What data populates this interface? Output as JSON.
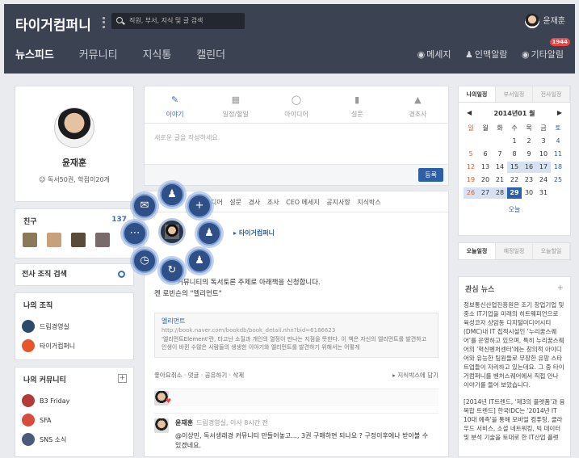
{
  "app": {
    "title": "타이거컴퍼니",
    "search_placeholder": "직원, 부서, 지식 및 글 검색",
    "user_name": "윤재훈"
  },
  "nav": {
    "tabs": [
      "뉴스피드",
      "커뮤니티",
      "지식통",
      "캘린더"
    ],
    "right": [
      {
        "label": "메세지",
        "icon": "chat-icon"
      },
      {
        "label": "인맥알람",
        "icon": "person-plus-icon"
      },
      {
        "label": "기타알림",
        "icon": "globe-icon",
        "badge": "1944"
      }
    ]
  },
  "profile": {
    "name": "윤재훈",
    "stats": "독서50권, 학점이20개"
  },
  "friends": {
    "title": "친구",
    "count": "137"
  },
  "org_search": {
    "label": "전사 조직 검색"
  },
  "my_org": {
    "title": "나의 조직",
    "items": [
      "드림경영실",
      "타이거컴퍼니"
    ]
  },
  "my_community": {
    "title": "나의 커뮤니티",
    "items": [
      "B3 Friday",
      "SFA",
      "SNS 소식"
    ]
  },
  "compose": {
    "tabs": [
      "이야기",
      "일정/할일",
      "아이디어",
      "설문",
      "경조사"
    ],
    "placeholder": "새로운 글을 작성하세요.",
    "submit": "등록"
  },
  "feed": {
    "filters": [
      "디어",
      "설문",
      "경사",
      "조사",
      "CEO 메세지",
      "공지사항",
      "지식박스"
    ],
    "org": "타이거컴퍼니",
    "post_line1": "커뮤니티의 독서토론 주제로 아래책을 신청합니다.",
    "post_line2": "켄 로빈슨의 \"엘리먼트\"",
    "link_title": "엘리먼트",
    "link_url": "http://book.naver.com/bookdb/book_detail.nhn?bid=6186623",
    "link_desc": "'엘리먼트Element'란, 타고난 소질과 개인의 열정이 만나는 지점을 뜻한다. 이 책은 자신의 엘리먼트를 발견하고 인생이 바뀐 수많은 사람들의 생생한 이야기와 엘리먼트를 발견하기 위해서는 어떻게",
    "actions": [
      "좋아요취소",
      "댓글",
      "공유하기",
      "삭제"
    ],
    "action_right": "지식박스에 담기",
    "comment_name": "윤재훈",
    "comment_meta": "드림경영실, 이사 8시간 전",
    "comment_text": "@이상민, 독서생래경 커뮤니티 만들어놓고..., 3권 구매하면 되나요 ? 구정이후에나 받아볼 수 있겠네요."
  },
  "calendar": {
    "tabs": [
      "나의일정",
      "부서일정",
      "전사일정"
    ],
    "month": "2014년01 월",
    "weekdays": [
      "일",
      "월",
      "화",
      "수",
      "목",
      "금",
      "토"
    ],
    "days": [
      "",
      "",
      "",
      "1",
      "2",
      "3",
      "4",
      "5",
      "6",
      "7",
      "8",
      "9",
      "10",
      "11",
      "12",
      "13",
      "14",
      "15",
      "16",
      "17",
      "18",
      "19",
      "20",
      "21",
      "22",
      "23",
      "24",
      "25",
      "26",
      "27",
      "28",
      "29",
      "30",
      "31",
      ""
    ],
    "today_label": "오늘"
  },
  "today_tabs": [
    "오늘일정",
    "예정일정",
    "오늘할일"
  ],
  "news": {
    "title": "관심 뉴스",
    "p1": "정보통신산업진흥원은 조기 창업기업 및 중소 IT기업을 미래의 히트웨피언으로 육성코자 상암동 디지털미디어시티(DMC)내 IT 집적시설인 '누리꿈스퀘어'를 운영하고 있으며, 특히 누리꿈스퀘어의 '혁신벤처센터'에는 창의적 아이디어와 유능한 팀원들로 무장한 유망 스타트업들이 자리하고 있는데요. 그 중 타이거컴퍼니를 벤처스퀘어에서 직접 만나 이야기를 들어 보았습니다.",
    "p2": "[2014년 IT트렌드, '제3의 플랫폼'과 융복합 트렌드] 한국IDC는 '2014년 IT 10대 예측'을 통해 모바일 컴퓨팅, 클라우드 서비스, 소셜 네트워킹, 빅 데이터 및 분석 기술을 토대로 한 IT산업 플랫"
  }
}
